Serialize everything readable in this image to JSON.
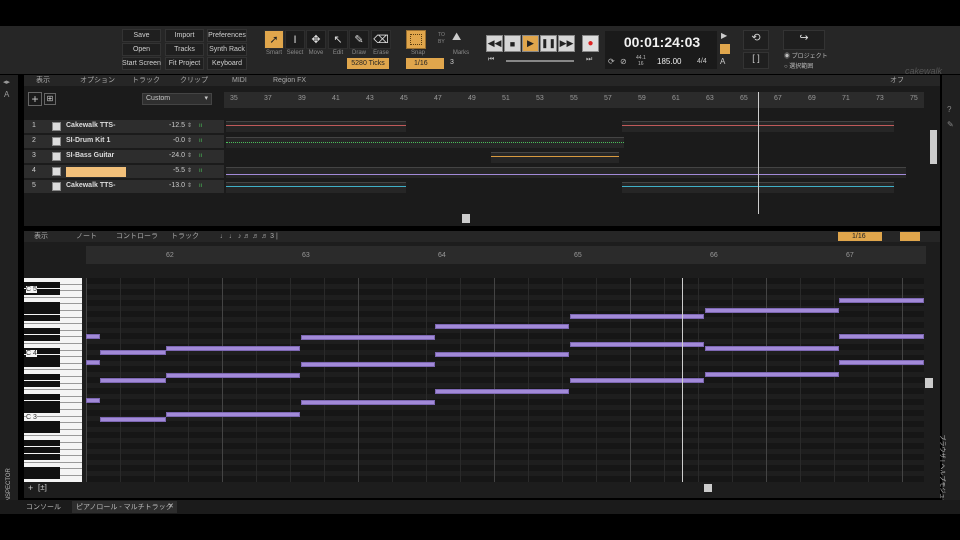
{
  "control_bar": {
    "file_buttons": [
      "Save",
      "Open",
      "Start Screen",
      "Import",
      "Tracks",
      "Fit Project",
      "Preferences",
      "Synth Rack",
      "Keyboard"
    ],
    "tools": [
      {
        "name": "Smart",
        "icon": "cursor-icon",
        "active": true
      },
      {
        "name": "Select",
        "icon": "text-cursor-icon"
      },
      {
        "name": "Move",
        "icon": "move-icon"
      },
      {
        "name": "Edit",
        "icon": "edit-icon"
      },
      {
        "name": "Draw",
        "icon": "pencil-icon"
      },
      {
        "name": "Erase",
        "icon": "eraser-icon"
      }
    ],
    "nudge": "5280 Ticks",
    "snap_label": "Snap",
    "snap_value": "1/16",
    "snap_extra": "3",
    "to_label": "TO",
    "by_label": "BY",
    "marks_label": "Marks",
    "time": "00:01:24:03",
    "sample_rate_top": "44.1",
    "sample_rate_bottom": "16",
    "tempo": "185.00",
    "meter": "4/4",
    "project_option": "プロジェクト",
    "selection_option": "選択範囲",
    "brand": "cakewalk"
  },
  "track_view": {
    "menu": [
      "表示",
      "オプション",
      "トラック",
      "クリップ",
      "MIDI",
      "Region FX"
    ],
    "off_label": "オフ",
    "preset": "Custom",
    "ruler": [
      "35",
      "37",
      "39",
      "41",
      "43",
      "45",
      "47",
      "49",
      "51",
      "53",
      "55",
      "57",
      "59",
      "61",
      "63",
      "65",
      "67",
      "69",
      "71",
      "73",
      "75"
    ],
    "tracks": [
      {
        "num": "1",
        "name": "Cakewalk TTS-",
        "vol": "-12.5",
        "color": "#c05a5a"
      },
      {
        "num": "2",
        "name": "SI-Drum Kit 1",
        "vol": "-0.0",
        "color": "#4bbf5a"
      },
      {
        "num": "3",
        "name": "SI-Bass Guitar",
        "vol": "-24.0",
        "color": "#d89a40"
      },
      {
        "num": "4",
        "name": "",
        "vol": "-5.5",
        "color": "#a28ad8"
      },
      {
        "num": "5",
        "name": "Cakewalk TTS-",
        "vol": "-13.0",
        "color": "#40b0c8"
      }
    ]
  },
  "piano_roll": {
    "menu": [
      "表示",
      "ノート",
      "コントローラ",
      "トラック"
    ],
    "snap_value": "1/16",
    "ruler": [
      "62",
      "63",
      "64",
      "65",
      "66",
      "67"
    ],
    "key_labels": [
      "C 5",
      "C 4",
      "C 3"
    ]
  },
  "inspector_label": "INSPECTOR",
  "browser_label": "ブラウザ | ヘルプモジュール",
  "bottom_tabs": [
    "コンソール",
    "ピアノロール - マルチトラック"
  ],
  "colors": {
    "accent": "#e0a64c",
    "note": "#a28ad8",
    "bg": "#1b1b1b"
  }
}
